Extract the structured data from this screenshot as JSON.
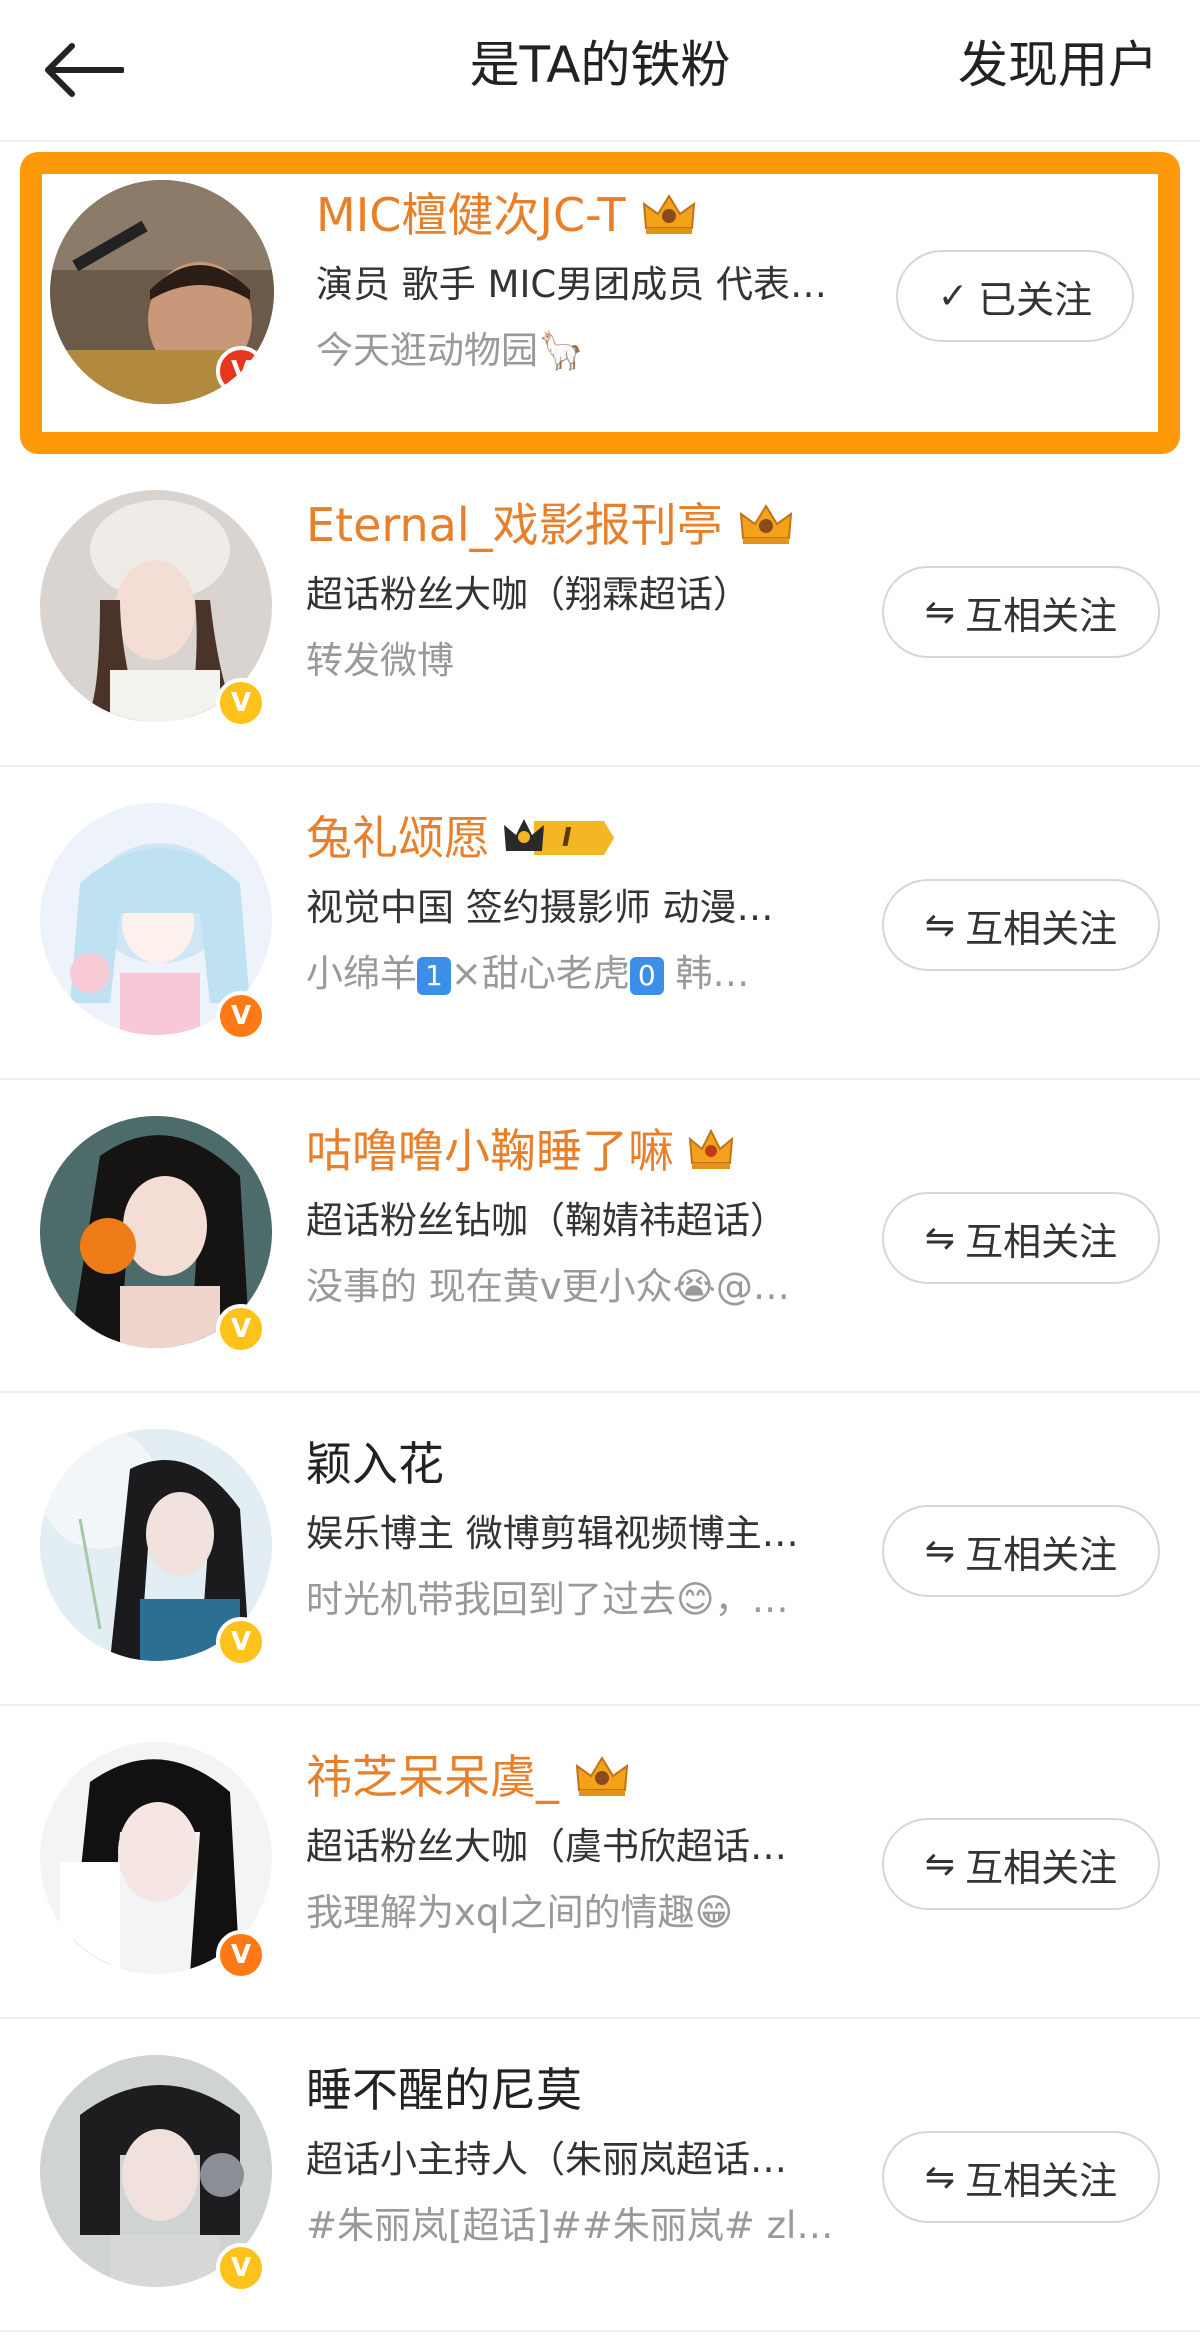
{
  "header": {
    "title": "是TA的铁粉",
    "action": "发现用户"
  },
  "colors": {
    "name_orange": "#e8802b",
    "highlight_border": "#fe9a0a",
    "verify_orange": "#ff7a14",
    "verify_yellow": "#ffc21a"
  },
  "users": [
    {
      "name": "MIC檀健次JC-T",
      "desc": "演员 歌手 MIC男团成员 代表…",
      "sub": "今天逛动物园🦙",
      "button": "已关注",
      "verify": "V"
    },
    {
      "name": "Eternal_戏影报刊亭",
      "desc": "超话粉丝大咖（翔霖超话）",
      "sub": "转发微博",
      "button": "互相关注",
      "verify": "V"
    },
    {
      "name": "兔礼颂愿",
      "desc": "视觉中国 签约摄影师 动漫…",
      "sub_parts": [
        "小绵羊",
        "1",
        "×甜心老虎",
        "0",
        "  韩…"
      ],
      "button": "互相关注",
      "verify": "V",
      "level_badge": "I"
    },
    {
      "name": "咕噜噜小鞠睡了嘛",
      "desc": "超话粉丝钻咖（鞠婧祎超话）",
      "sub": "没事的 现在黄v更小众😭@…",
      "button": "互相关注",
      "verify": "V"
    },
    {
      "name": "颖入花",
      "desc": "娱乐博主 微博剪辑视频博主…",
      "sub": "时光机带我回到了过去😊，…",
      "button": "互相关注",
      "verify": "V"
    },
    {
      "name": "祎芝呆呆虞_",
      "desc": "超话粉丝大咖（虞书欣超话…",
      "sub": "我理解为xql之间的情趣😁",
      "button": "互相关注",
      "verify": "V"
    },
    {
      "name": "睡不醒的尼莫",
      "desc": "超话小主持人（朱丽岚超话…",
      "sub": "#朱丽岚[超话]##朱丽岚# zl…",
      "button": "互相关注",
      "verify": "V"
    }
  ]
}
